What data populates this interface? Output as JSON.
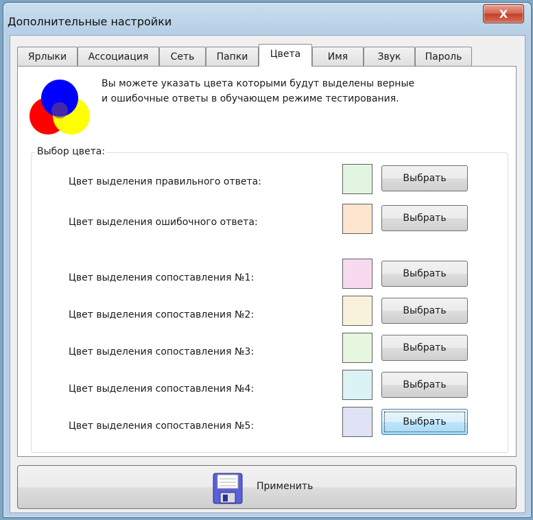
{
  "window": {
    "title": "Дополнительные настройки",
    "close_glyph": "X"
  },
  "tabs": [
    {
      "label": "Ярлыки",
      "active": false
    },
    {
      "label": "Ассоциация",
      "active": false
    },
    {
      "label": "Сеть",
      "active": false
    },
    {
      "label": "Папки",
      "active": false
    },
    {
      "label": "Цвета",
      "active": true
    },
    {
      "label": "Имя",
      "active": false
    },
    {
      "label": "Звук",
      "active": false
    },
    {
      "label": "Пароль",
      "active": false
    }
  ],
  "colors_page": {
    "description_line1": "Вы можете указать цвета  которыми будут выделены верные",
    "description_line2": "и ошибочные ответы в обучающем режиме тестирования.",
    "logo_icon": "rgb-color-circles-icon",
    "group_title": "Выбор цвета:",
    "rows": [
      {
        "label": "Цвет выделения правильного ответа:",
        "color": "#e2f5e0",
        "button": "Выбрать"
      },
      {
        "label": "Цвет выделения ошибочного ответа:",
        "color": "#fde5cf",
        "button": "Выбрать"
      },
      {
        "label": "Цвет выделения сопоставления №1:",
        "color": "#f7daf0",
        "button": "Выбрать"
      },
      {
        "label": "Цвет выделения сопоставления №2:",
        "color": "#f8f2dc",
        "button": "Выбрать"
      },
      {
        "label": "Цвет выделения сопоставления №3:",
        "color": "#e6f6df",
        "button": "Выбрать"
      },
      {
        "label": "Цвет выделения сопоставления №4:",
        "color": "#dcf3f5",
        "button": "Выбрать"
      },
      {
        "label": "Цвет выделения сопоставления №5:",
        "color": "#e0e2f5",
        "button": "Выбрать"
      }
    ]
  },
  "apply": {
    "label": "Применить",
    "icon": "floppy-disk-icon"
  }
}
